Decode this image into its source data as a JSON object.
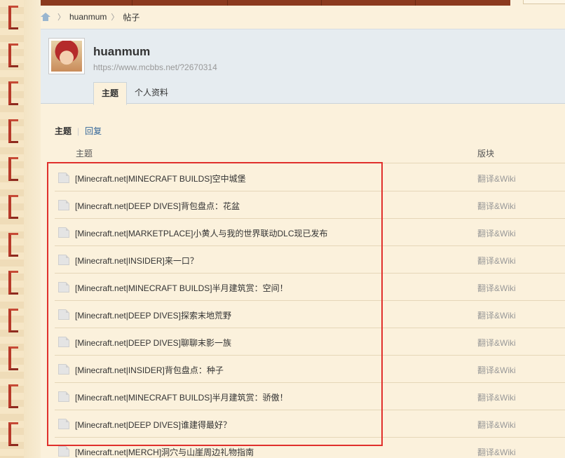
{
  "breadcrumb": {
    "items": [
      "huanmum",
      "帖子"
    ]
  },
  "profile": {
    "username": "huanmum",
    "url": "https://www.mcbbs.net/?2670314",
    "tabs": [
      {
        "label": "主题",
        "active": true
      },
      {
        "label": "个人资料",
        "active": false
      }
    ]
  },
  "subnav": {
    "active": "主题",
    "divider": "|",
    "other": "回复"
  },
  "table": {
    "columns": {
      "topic": "主题",
      "forum": "版块"
    },
    "rows": [
      {
        "title": "[Minecraft.net|MINECRAFT BUILDS]空中城堡",
        "forum": "翻译&Wiki"
      },
      {
        "title": "[Minecraft.net|DEEP DIVES]背包盘点：花盆",
        "forum": "翻译&Wiki"
      },
      {
        "title": "[Minecraft.net|MARKETPLACE]小黄人与我的世界联动DLC现已发布",
        "forum": "翻译&Wiki"
      },
      {
        "title": "[Minecraft.net|INSIDER]来一口？",
        "forum": "翻译&Wiki"
      },
      {
        "title": "[Minecraft.net|MINECRAFT BUILDS]半月建筑赏：空间！",
        "forum": "翻译&Wiki"
      },
      {
        "title": "[Minecraft.net|DEEP DIVES]探索末地荒野",
        "forum": "翻译&Wiki"
      },
      {
        "title": "[Minecraft.net|DEEP DIVES]聊聊末影一族",
        "forum": "翻译&Wiki"
      },
      {
        "title": "[Minecraft.net|INSIDER]背包盘点：种子",
        "forum": "翻译&Wiki"
      },
      {
        "title": "[Minecraft.net|MINECRAFT BUILDS]半月建筑赏：骄傲！",
        "forum": "翻译&Wiki"
      },
      {
        "title": "[Minecraft.net|DEEP DIVES]谁建得最好？",
        "forum": "翻译&Wiki"
      },
      {
        "title": "[Minecraft.net|MERCH]洞穴与山崖周边礼物指南",
        "forum": "翻译&Wiki"
      }
    ]
  },
  "colors": {
    "page_bg": "#fbf1dc",
    "header_bg": "#e6ecf0",
    "highlight": "#e0302c",
    "link": "#336699",
    "brick_red": "#b83a2a"
  }
}
